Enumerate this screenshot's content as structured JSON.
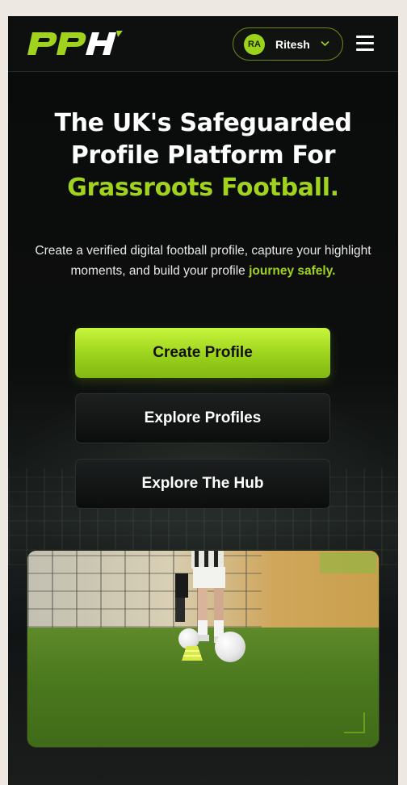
{
  "header": {
    "logo_text": "PPH",
    "user": {
      "initials": "RA",
      "name": "Ritesh"
    },
    "menu_icon": "hamburger-icon",
    "chevron_icon": "chevron-down-icon"
  },
  "hero": {
    "title_line1": "The UK's Safeguarded",
    "title_line2": "Profile Platform For",
    "title_accent": "Grassroots Football.",
    "subtitle": "Create a verified digital football profile, capture your highlight moments, and build your profile ",
    "subtitle_accent": "journey safely."
  },
  "actions": {
    "create_profile": "Create Profile",
    "explore_profiles": "Explore Profiles",
    "explore_hub": "Explore The Hub"
  },
  "colors": {
    "accent": "#a0d21e",
    "background": "#0b0d0c",
    "page_backdrop": "#eee8e2"
  }
}
